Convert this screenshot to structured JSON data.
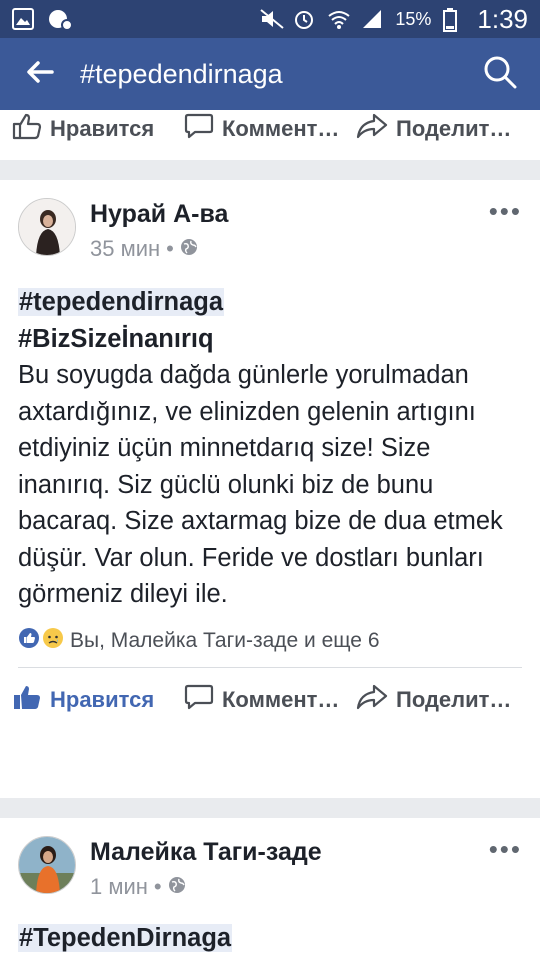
{
  "status": {
    "battery": "15%",
    "time": "1:39"
  },
  "appbar": {
    "title": "#tepedendirnaga"
  },
  "actions": {
    "like": "Нравится",
    "comment": "Коммент…",
    "share": "Поделит…"
  },
  "post1": {
    "author": "Нурай А-ва",
    "time": "35 мин",
    "hashtag1": "#tepedendirnaga",
    "hashtag2": "#BizSizeİnanırıq",
    "text": "Bu soyugda dağda günlerle yorulmadan axtardığınız, ve elinizden gelenin artıgını etdiyiniz üçün minnetdarıq size! Size inanırıq. Siz güclü olunki biz de bunu bacaraq. Size axtarmag bize de dua etmek düşür. Var olun. Feride ve dostları bunları görmeniz dileyi ile.",
    "reactions_text": "Вы, Малейка Таги-заде и еще 6"
  },
  "post2": {
    "author": "Малейка Таги-заде",
    "time": "1 мин",
    "hashtag1": "#TepedenDirnaga"
  },
  "colors": {
    "statusbar": "#2d4373",
    "appbar": "#3b5998",
    "like_active": "#4267b2"
  }
}
